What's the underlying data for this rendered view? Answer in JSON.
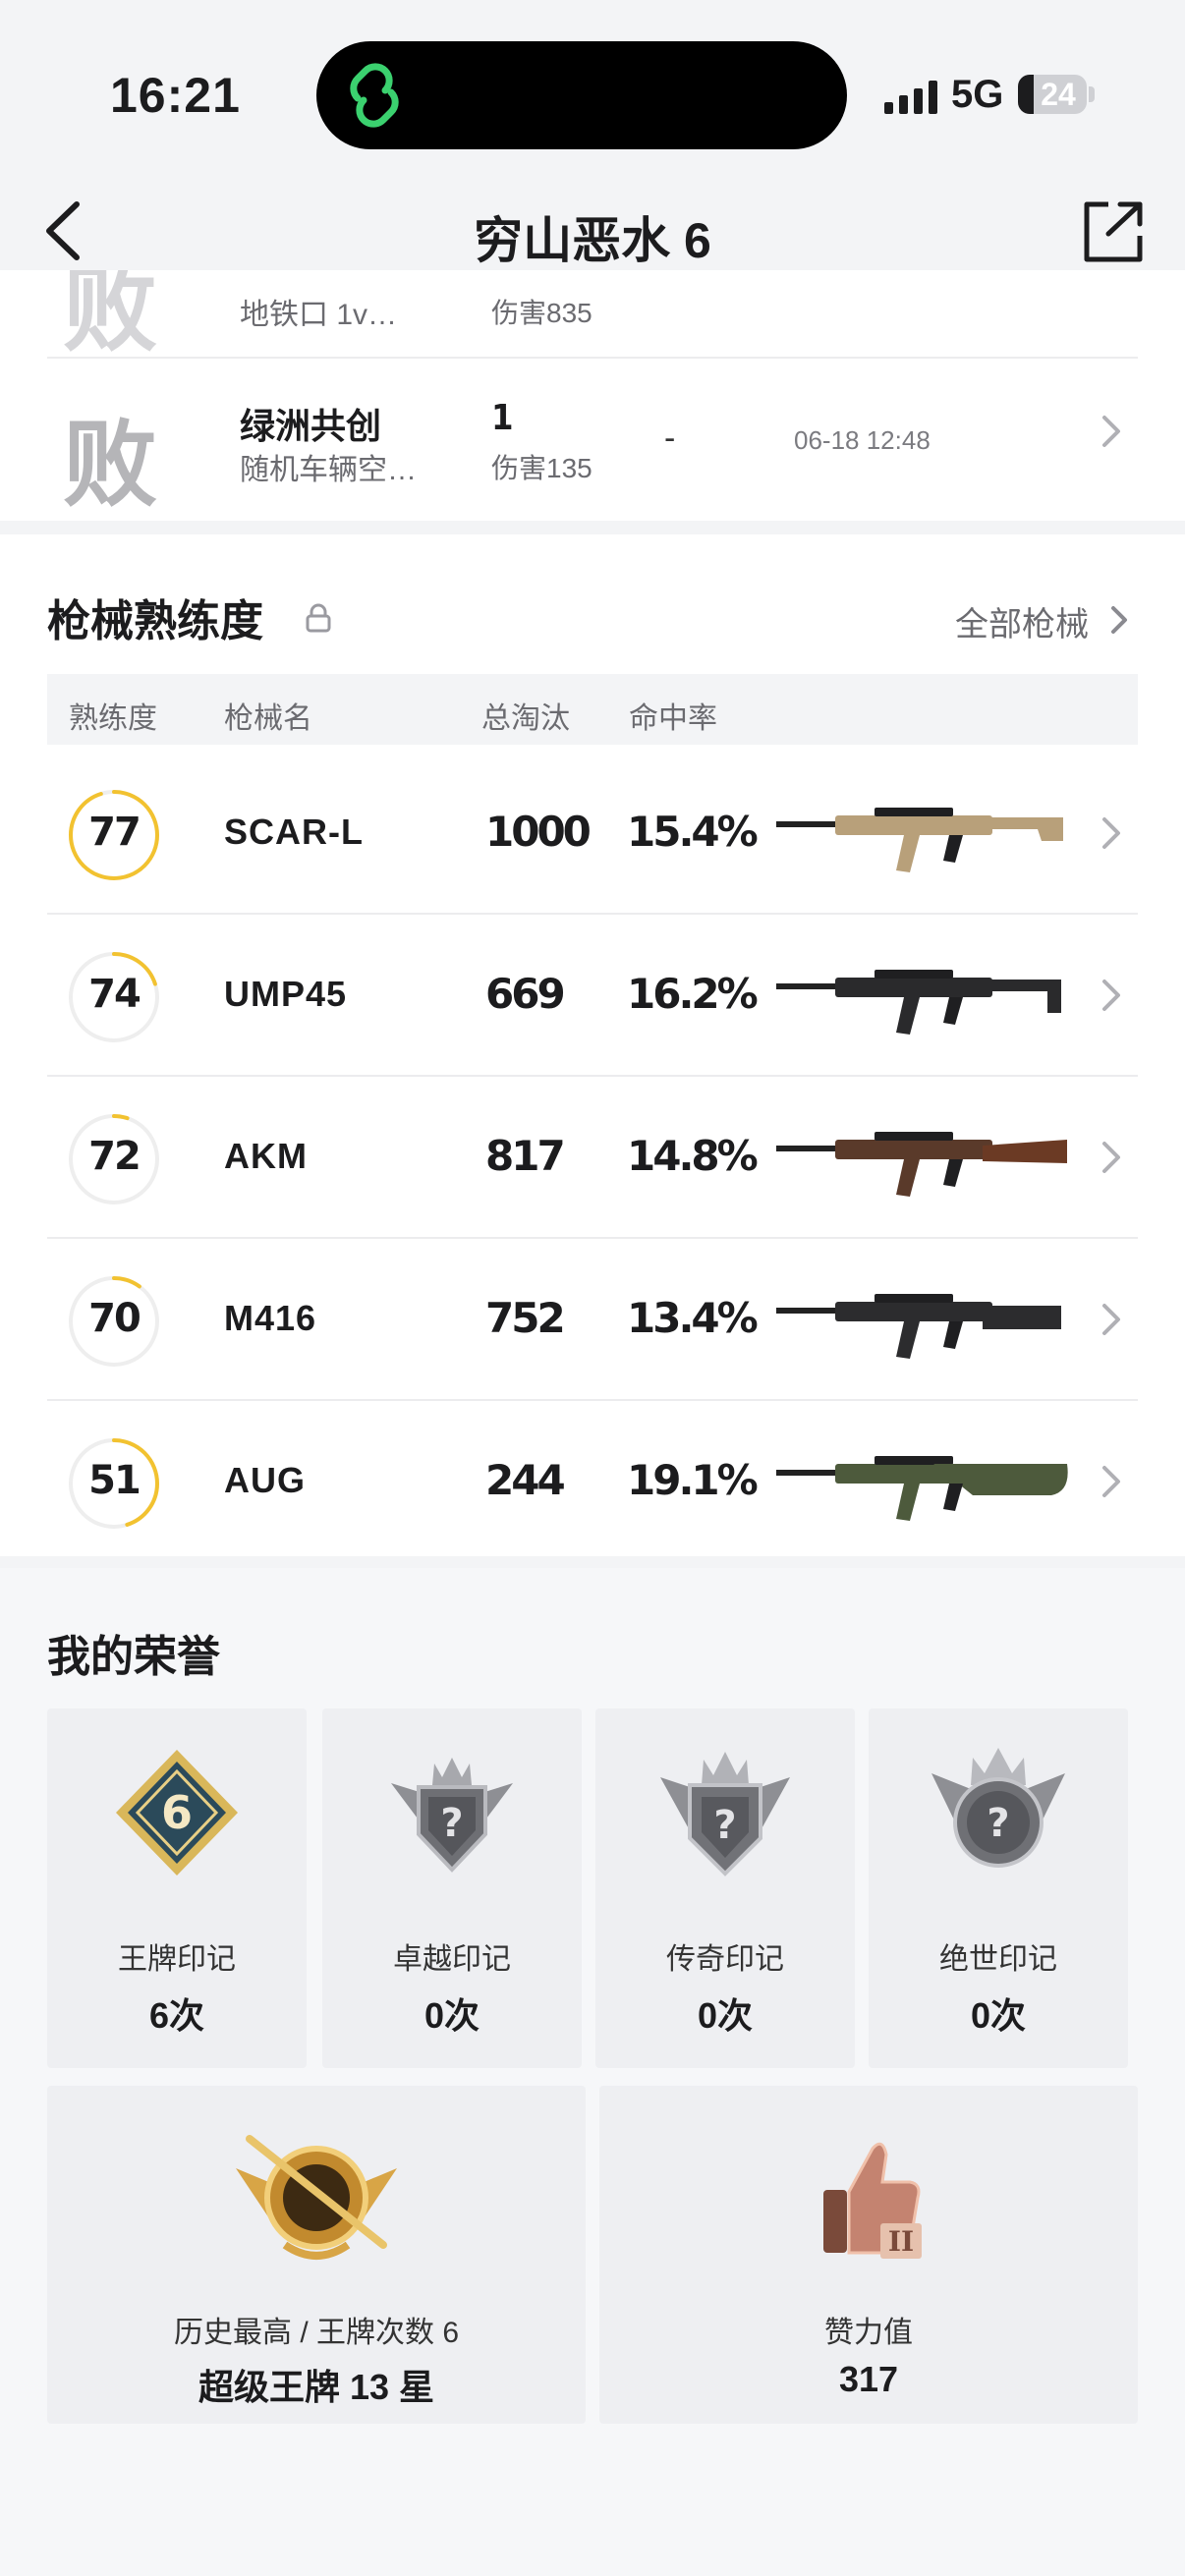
{
  "status_bar": {
    "time": "16:21",
    "network": "5G",
    "battery": "24"
  },
  "nav": {
    "title": "穷山恶水 6"
  },
  "matches": [
    {
      "result_icon_text": "败",
      "mode": "",
      "sub": "地铁口 1v…",
      "rank": "",
      "damage": "伤害835",
      "extra": "",
      "time": ""
    },
    {
      "result_icon_text": "败",
      "mode": "绿洲共创",
      "sub": "随机车辆空…",
      "rank": "1",
      "damage": "伤害135",
      "extra": "-",
      "time": "06-18 12:48"
    }
  ],
  "gun_section": {
    "title": "枪械熟练度",
    "see_all": "全部枪械",
    "headers": {
      "proficiency": "熟练度",
      "name": "枪械名",
      "kills": "总淘汰",
      "accuracy": "命中率"
    },
    "ring_color": "#f2c230",
    "ring_track_color": "#eeeeee",
    "guns": [
      {
        "proficiency": "77",
        "name": "SCAR-L",
        "kills": "1000",
        "accuracy": "15.4%",
        "progress": 0.95,
        "icon": "scar-l-rifle-icon"
      },
      {
        "proficiency": "74",
        "name": "UMP45",
        "kills": "669",
        "accuracy": "16.2%",
        "progress": 0.2,
        "icon": "ump45-smg-icon"
      },
      {
        "proficiency": "72",
        "name": "AKM",
        "kills": "817",
        "accuracy": "14.8%",
        "progress": 0.05,
        "icon": "akm-rifle-icon"
      },
      {
        "proficiency": "70",
        "name": "M416",
        "kills": "752",
        "accuracy": "13.4%",
        "progress": 0.1,
        "icon": "m416-rifle-icon"
      },
      {
        "proficiency": "51",
        "name": "AUG",
        "kills": "244",
        "accuracy": "19.1%",
        "progress": 0.45,
        "icon": "aug-rifle-icon"
      }
    ]
  },
  "honor_section": {
    "title": "我的荣誉",
    "marks": [
      {
        "name": "王牌印记",
        "count": "6次",
        "emblem_text": "6",
        "icon": "ace-mark-emblem-icon"
      },
      {
        "name": "卓越印记",
        "count": "0次",
        "emblem_text": "?",
        "icon": "excellence-mark-emblem-icon"
      },
      {
        "name": "传奇印记",
        "count": "0次",
        "emblem_text": "?",
        "icon": "legend-mark-emblem-icon"
      },
      {
        "name": "绝世印记",
        "count": "0次",
        "emblem_text": "?",
        "icon": "peerless-mark-emblem-icon"
      }
    ],
    "highest": {
      "label": "历史最高 / 王牌次数 6",
      "value": "超级王牌 13 星",
      "icon": "super-ace-rank-emblem-icon"
    },
    "likes": {
      "label": "赞力值",
      "value": "317",
      "icon": "thumbs-up-badge-icon"
    }
  }
}
